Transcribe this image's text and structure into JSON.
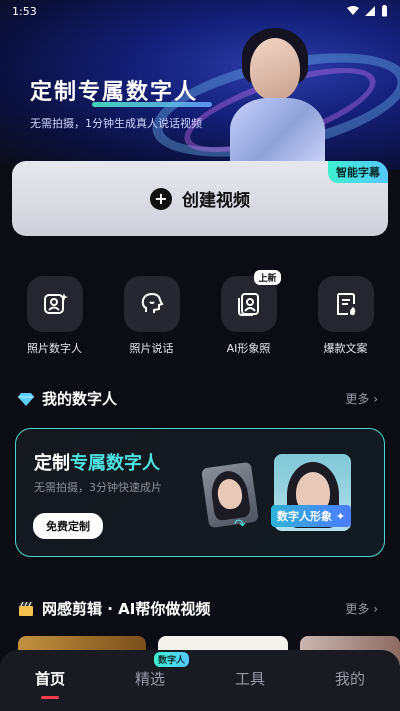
{
  "status": {
    "time": "1:53"
  },
  "hero": {
    "title": "定制专属数字人",
    "subtitle": "无需拍摄，1分钟生成真人说话视频"
  },
  "create": {
    "label": "创建视频",
    "badge": "智能字幕"
  },
  "tools": [
    {
      "label": "照片数字人",
      "icon": "photo-person-icon"
    },
    {
      "label": "照片说话",
      "icon": "talking-head-icon"
    },
    {
      "label": "AI形象照",
      "icon": "ai-portrait-icon",
      "tag": "上新"
    },
    {
      "label": "爆款文案",
      "icon": "hot-copy-icon"
    }
  ],
  "my_digital": {
    "title": "我的数字人",
    "more": "更多"
  },
  "custom_card": {
    "title_prefix": "定制",
    "title_highlight": "专属数字人",
    "subtitle": "无需拍摄，3分钟快速成片",
    "button": "免费定制",
    "tag": "数字人形象"
  },
  "editing": {
    "title": "网感剪辑 · AI帮你做视频",
    "more": "更多"
  },
  "tabs": [
    {
      "label": "首页",
      "active": true
    },
    {
      "label": "精选",
      "tag": "数字人"
    },
    {
      "label": "工具"
    },
    {
      "label": "我的"
    }
  ],
  "colors": {
    "accent": "#4de3e0",
    "indicator": "#ff3b4e",
    "background": "#0c0d14"
  }
}
